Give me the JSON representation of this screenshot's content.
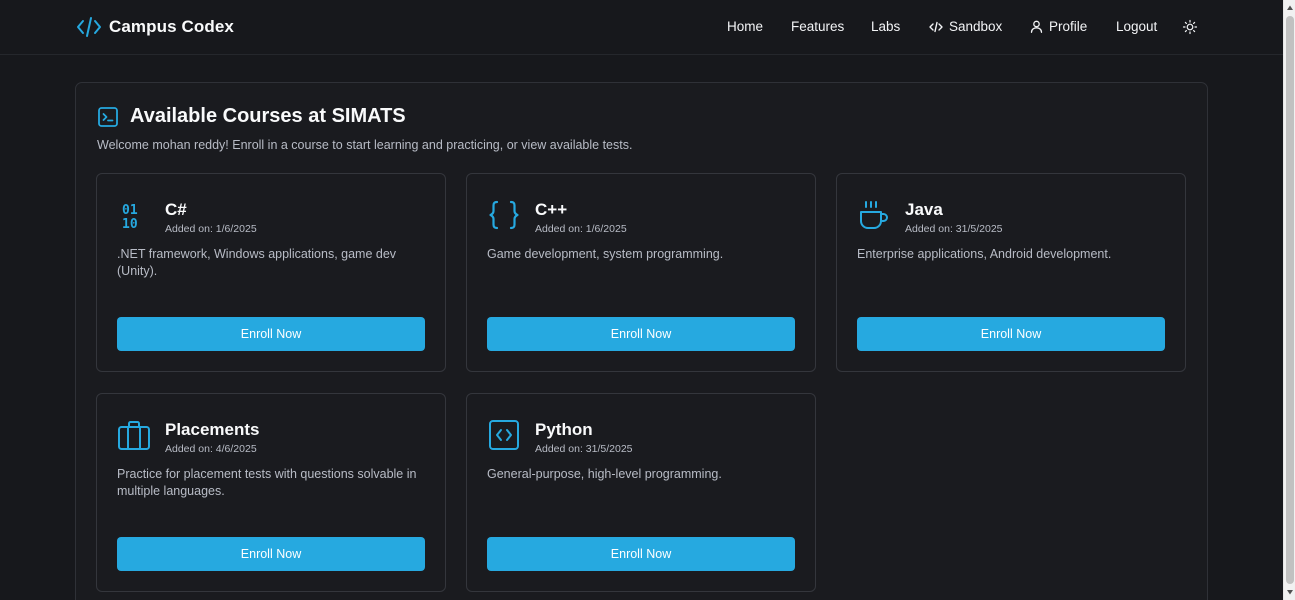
{
  "app": {
    "name": "Campus Codex",
    "logo_icon": "code-brackets-icon"
  },
  "nav": {
    "home": "Home",
    "features": "Features",
    "labs": "Labs",
    "sandbox": "Sandbox",
    "profile": "Profile",
    "logout": "Logout",
    "theme_icon": "sun-icon"
  },
  "page": {
    "title": "Available Courses at SIMATS",
    "title_icon": "terminal-icon",
    "welcome": "Welcome mohan reddy! Enroll in a course to start learning and practicing, or view available tests."
  },
  "courses": [
    {
      "name": "C#",
      "added": "Added on: 1/6/2025",
      "description": ".NET framework, Windows applications, game dev (Unity).",
      "icon": "binary-icon",
      "button": "Enroll Now"
    },
    {
      "name": "C++",
      "added": "Added on: 1/6/2025",
      "description": "Game development, system programming.",
      "icon": "braces-icon",
      "button": "Enroll Now"
    },
    {
      "name": "Java",
      "added": "Added on: 31/5/2025",
      "description": "Enterprise applications, Android development.",
      "icon": "coffee-cup-icon",
      "button": "Enroll Now"
    },
    {
      "name": "Placements",
      "added": "Added on: 4/6/2025",
      "description": "Practice for placement tests with questions solvable in multiple languages.",
      "icon": "briefcase-icon",
      "button": "Enroll Now"
    },
    {
      "name": "Python",
      "added": "Added on: 31/5/2025",
      "description": "General-purpose, high-level programming.",
      "icon": "code-square-icon",
      "button": "Enroll Now"
    }
  ],
  "colors": {
    "background": "#17181c",
    "card_border": "#34363c",
    "accent": "#26a9e0",
    "text_primary": "#f9fafb",
    "text_secondary": "#b8bcc6"
  }
}
